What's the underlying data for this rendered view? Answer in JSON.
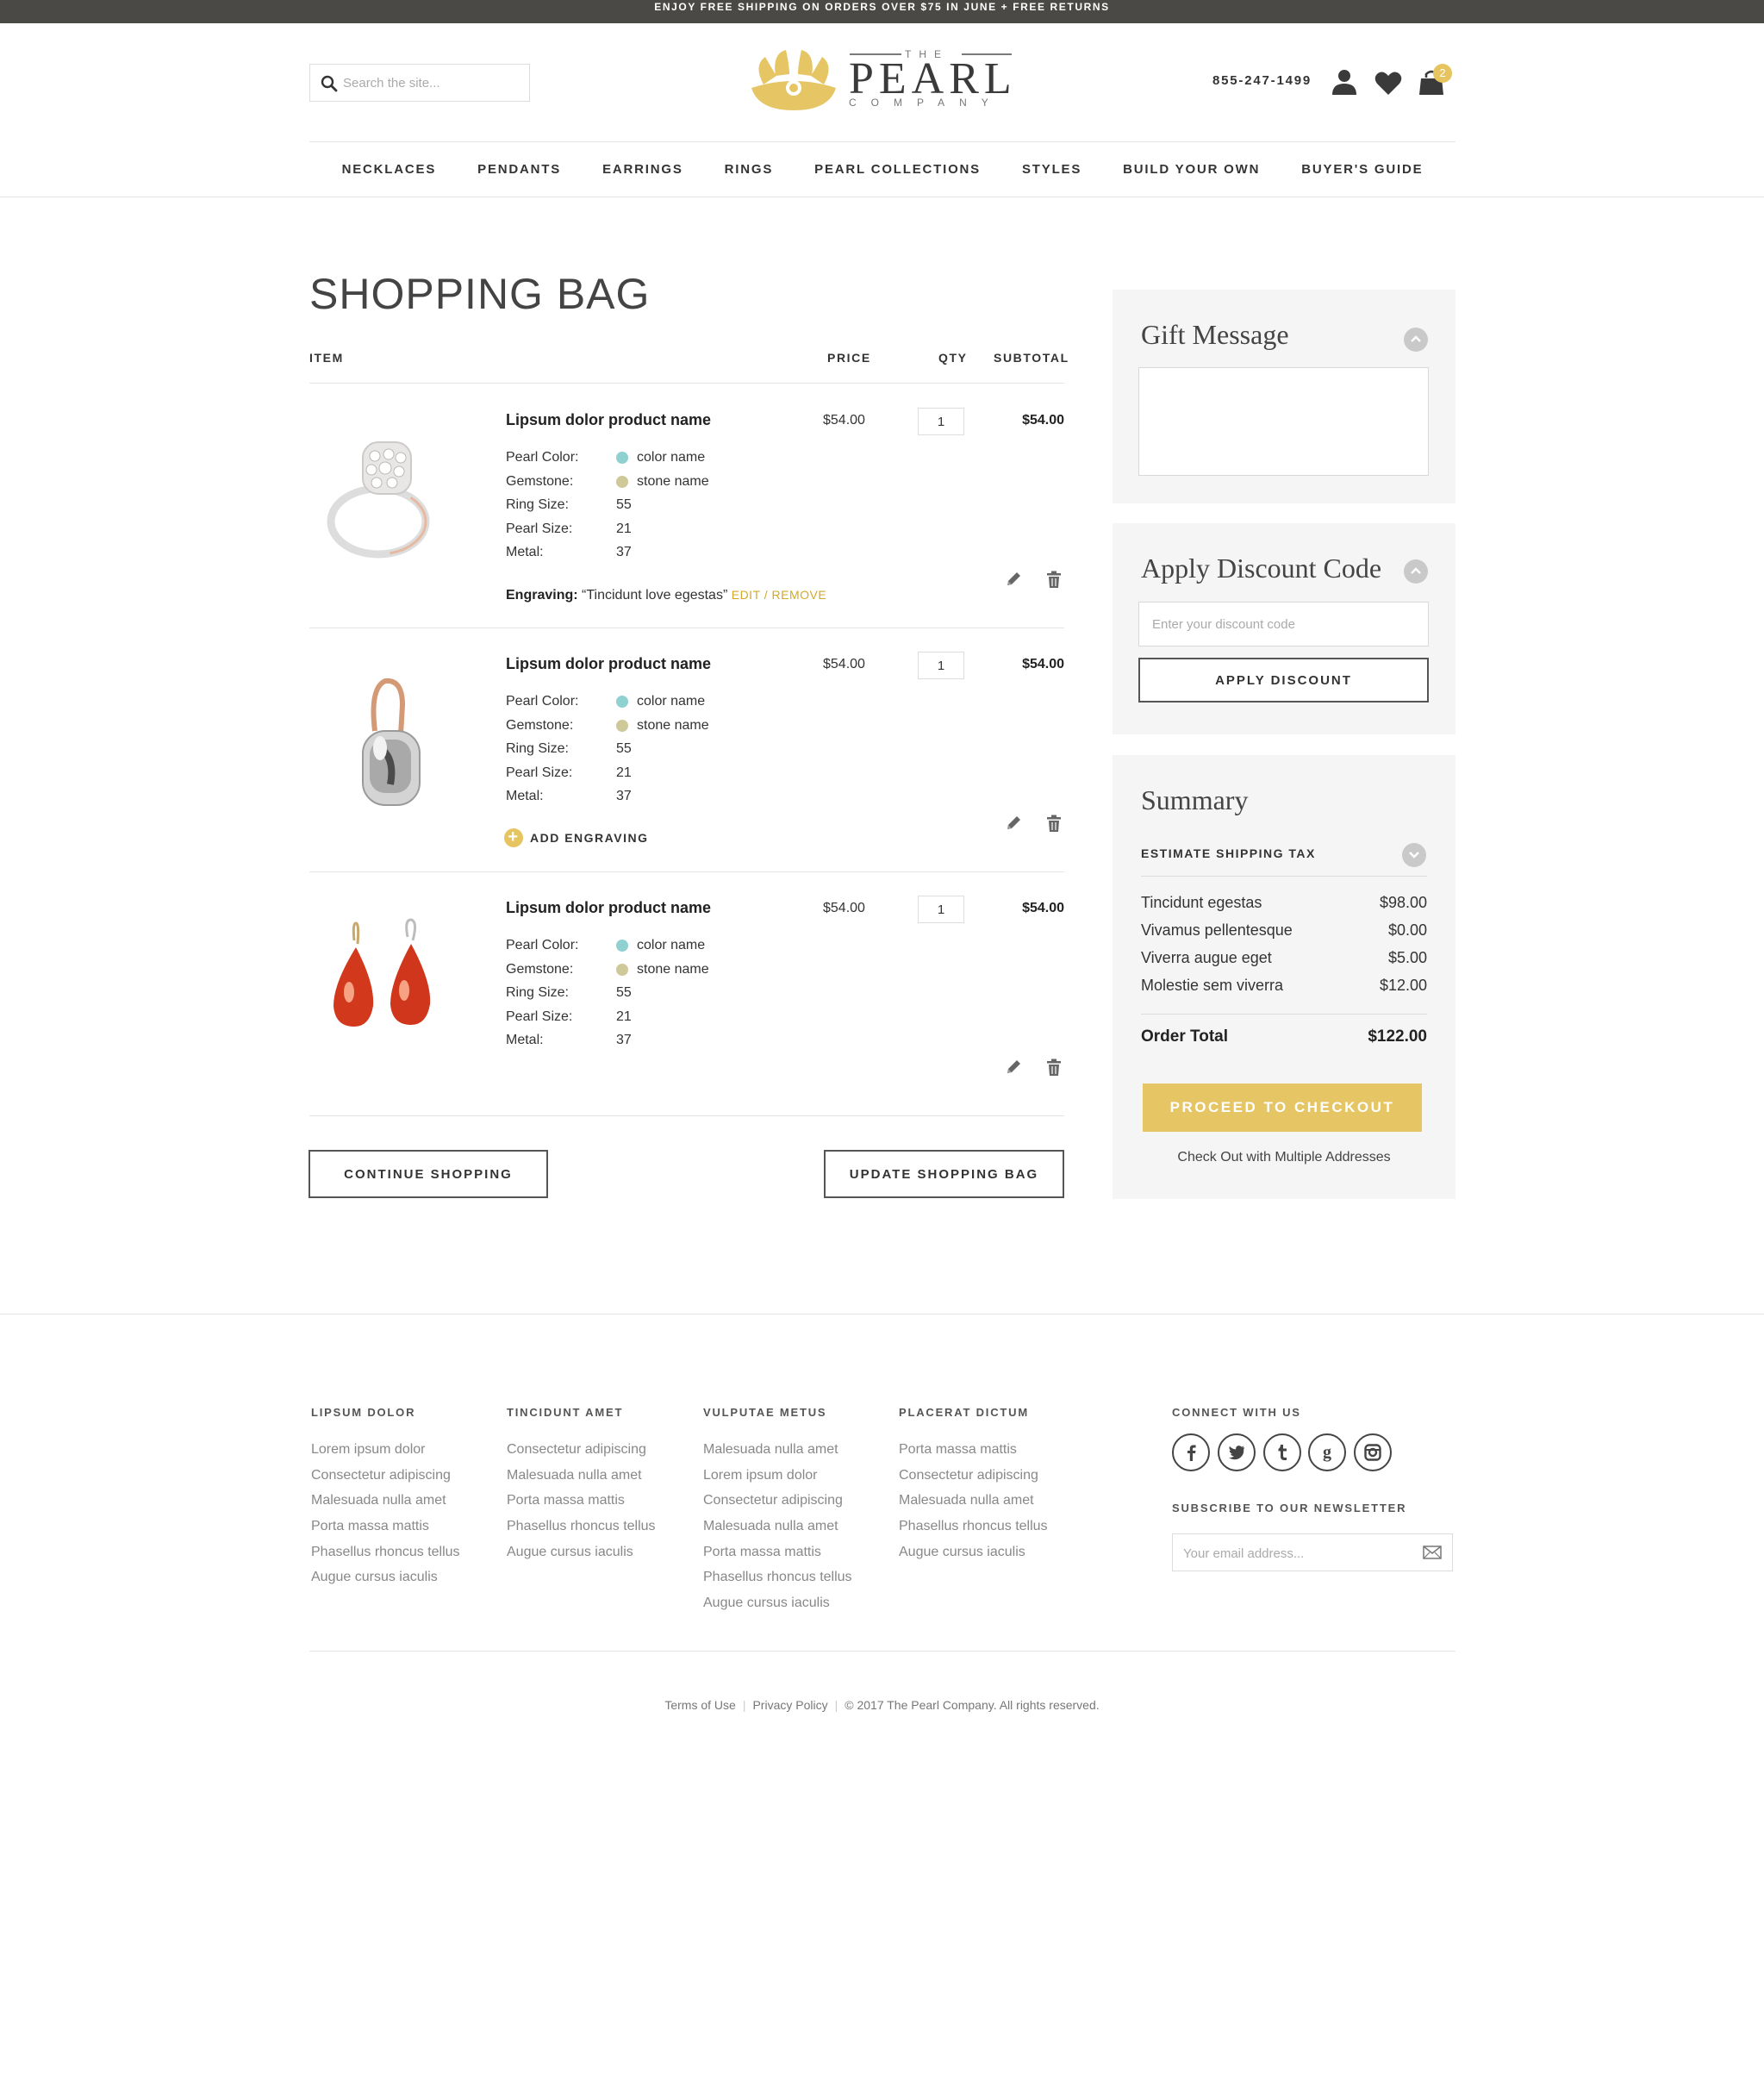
{
  "announcement": "ENJOY FREE SHIPPING ON ORDERS OVER $75 IN JUNE + FREE RETURNS",
  "header": {
    "search_placeholder": "Search the site...",
    "logo": {
      "the": "THE",
      "pearl": "PEARL",
      "company": "COMPANY"
    },
    "phone": "855-247-1499",
    "cart_count": "2",
    "icons": [
      "search-icon",
      "user-icon",
      "heart-icon",
      "bag-icon"
    ]
  },
  "nav": [
    "NECKLACES",
    "PENDANTS",
    "EARRINGS",
    "RINGS",
    "PEARL COLLECTIONS",
    "STYLES",
    "BUILD YOUR OWN",
    "BUYER'S GUIDE"
  ],
  "bag": {
    "title": "SHOPPING BAG",
    "columns": {
      "item": "ITEM",
      "price": "PRICE",
      "qty": "QTY",
      "subtotal": "SUBTOTAL"
    },
    "spec_labels": {
      "pearl_color": "Pearl Color:",
      "gemstone": "Gemstone:",
      "ring_size": "Ring Size:",
      "pearl_size": "Pearl Size:",
      "metal": "Metal:"
    },
    "items": [
      {
        "name": "Lipsum dolor product name",
        "price": "$54.00",
        "qty": "1",
        "subtotal": "$54.00",
        "pearl_color": "color name",
        "gemstone": "stone name",
        "ring_size": "55",
        "pearl_size": "21",
        "metal": "37",
        "image": "ring",
        "engraving_label": "Engraving:",
        "engraving_text": "“Tincidunt love egestas”",
        "engraving_actions": "EDIT / REMOVE"
      },
      {
        "name": "Lipsum dolor product name",
        "price": "$54.00",
        "qty": "1",
        "subtotal": "$54.00",
        "pearl_color": "color name",
        "gemstone": "stone name",
        "ring_size": "55",
        "pearl_size": "21",
        "metal": "37",
        "image": "pendant-earring",
        "add_engraving": "ADD ENGRAVING"
      },
      {
        "name": "Lipsum dolor product name",
        "price": "$54.00",
        "qty": "1",
        "subtotal": "$54.00",
        "pearl_color": "color name",
        "gemstone": "stone name",
        "ring_size": "55",
        "pearl_size": "21",
        "metal": "37",
        "image": "red-drop-earrings"
      }
    ],
    "dot_colors": {
      "pearl": "#8fd0d1",
      "stone": "#cfc898"
    },
    "continue_label": "CONTINUE SHOPPING",
    "update_label": "UPDATE SHOPPING BAG"
  },
  "sidebar": {
    "gift_title": "Gift Message",
    "discount_title": "Apply Discount Code",
    "discount_placeholder": "Enter your discount code",
    "apply_label": "APPLY DISCOUNT",
    "summary_title": "Summary",
    "estimate_label": "ESTIMATE SHIPPING TAX",
    "lines": [
      {
        "label": "Tincidunt egestas",
        "value": "$98.00"
      },
      {
        "label": "Vivamus pellentesque",
        "value": "$0.00"
      },
      {
        "label": "Viverra augue eget",
        "value": "$5.00"
      },
      {
        "label": "Molestie sem viverra",
        "value": "$12.00"
      }
    ],
    "total_label": "Order Total",
    "total_value": "$122.00",
    "checkout_label": "PROCEED TO CHECKOUT",
    "multi_label": "Check Out with Multiple Addresses"
  },
  "footer": {
    "columns": [
      {
        "title": "LIPSUM DOLOR",
        "links": [
          "Lorem ipsum dolor",
          "Consectetur adipiscing",
          "Malesuada nulla amet",
          "Porta massa mattis",
          "Phasellus rhoncus tellus",
          "Augue cursus iaculis"
        ]
      },
      {
        "title": "TINCIDUNT AMET",
        "links": [
          "Consectetur adipiscing",
          "Malesuada nulla amet",
          "Porta massa mattis",
          "Phasellus rhoncus tellus",
          "Augue cursus iaculis"
        ]
      },
      {
        "title": "VULPUTAE METUS",
        "links": [
          "Malesuada nulla amet",
          "Lorem ipsum dolor",
          "Consectetur adipiscing",
          "Malesuada nulla amet",
          "Porta massa mattis",
          "Phasellus rhoncus tellus",
          "Augue cursus iaculis"
        ]
      },
      {
        "title": "PLACERAT DICTUM",
        "links": [
          "Porta massa mattis",
          "Consectetur adipiscing",
          "Malesuada nulla amet",
          "Phasellus rhoncus tellus",
          "Augue cursus iaculis"
        ]
      }
    ],
    "connect_title": "CONNECT WITH US",
    "social": [
      "facebook-icon",
      "twitter-icon",
      "tumblr-icon",
      "google-icon",
      "instagram-icon"
    ],
    "newsletter_title": "SUBSCRIBE TO OUR NEWSLETTER",
    "newsletter_placeholder": "Your email address...",
    "legal": {
      "terms": "Terms of Use",
      "privacy": "Privacy Policy",
      "copyright": "© 2017 The Pearl Company. All rights reserved."
    }
  },
  "colors": {
    "gold": "#e6c565",
    "topbar": "#4a4946",
    "panel": "#f5f5f5"
  }
}
